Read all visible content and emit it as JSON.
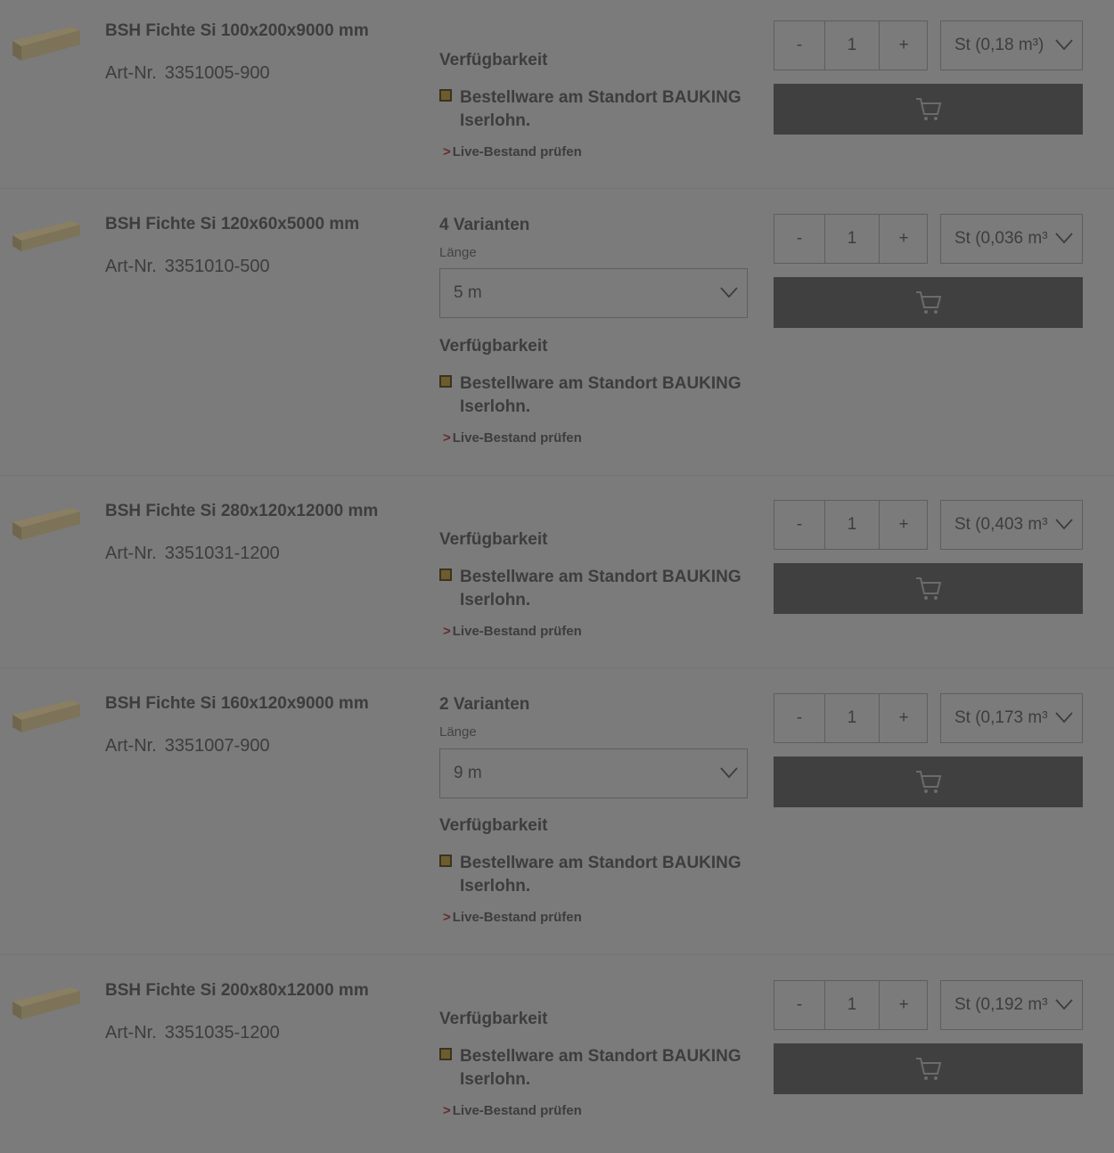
{
  "products": [
    {
      "title": "BSH Fichte Si 100x200x9000 mm",
      "art_label": "Art-Nr.",
      "art_nr": "3351005-900",
      "variants": "",
      "variant_label": "",
      "variant_value": "",
      "availability_label": "Verfügbarkeit",
      "status_text": "Bestellware am Standort BAUKING Iserlohn.",
      "live_check": "Live-Bestand prüfen",
      "qty_minus": "-",
      "qty_value": "1",
      "qty_plus": "+",
      "unit": "St (0,18 m³)"
    },
    {
      "title": "BSH Fichte Si 120x60x5000 mm",
      "art_label": "Art-Nr.",
      "art_nr": "3351010-500",
      "variants": "4 Varianten",
      "variant_label": "Länge",
      "variant_value": "5 m",
      "availability_label": "Verfügbarkeit",
      "status_text": "Bestellware am Standort BAUKING Iserlohn.",
      "live_check": "Live-Bestand prüfen",
      "qty_minus": "-",
      "qty_value": "1",
      "qty_plus": "+",
      "unit": "St (0,036 m³"
    },
    {
      "title": "BSH Fichte Si 280x120x12000 mm",
      "art_label": "Art-Nr.",
      "art_nr": "3351031-1200",
      "variants": "",
      "variant_label": "",
      "variant_value": "",
      "availability_label": "Verfügbarkeit",
      "status_text": "Bestellware am Standort BAUKING Iserlohn.",
      "live_check": "Live-Bestand prüfen",
      "qty_minus": "-",
      "qty_value": "1",
      "qty_plus": "+",
      "unit": "St (0,403 m³"
    },
    {
      "title": "BSH Fichte Si 160x120x9000 mm",
      "art_label": "Art-Nr.",
      "art_nr": "3351007-900",
      "variants": "2 Varianten",
      "variant_label": "Länge",
      "variant_value": "9 m",
      "availability_label": "Verfügbarkeit",
      "status_text": "Bestellware am Standort BAUKING Iserlohn.",
      "live_check": "Live-Bestand prüfen",
      "qty_minus": "-",
      "qty_value": "1",
      "qty_plus": "+",
      "unit": "St (0,173 m³"
    },
    {
      "title": "BSH Fichte Si 200x80x12000 mm",
      "art_label": "Art-Nr.",
      "art_nr": "3351035-1200",
      "variants": "",
      "variant_label": "",
      "variant_value": "",
      "availability_label": "Verfügbarkeit",
      "status_text": "Bestellware am Standort BAUKING Iserlohn.",
      "live_check": "Live-Bestand prüfen",
      "qty_minus": "-",
      "qty_value": "1",
      "qty_plus": "+",
      "unit": "St (0,192 m³"
    }
  ],
  "colors": {
    "overlay_background": "#7b7b7b",
    "cart_button": "#404040",
    "status_square": "#6e5d2c",
    "live_arrow": "#6a2a2a"
  },
  "icons": {
    "product_image": "timber-beam-icon",
    "dropdown": "chevron-down-icon",
    "cart": "cart-icon",
    "status": "status-square-icon"
  }
}
